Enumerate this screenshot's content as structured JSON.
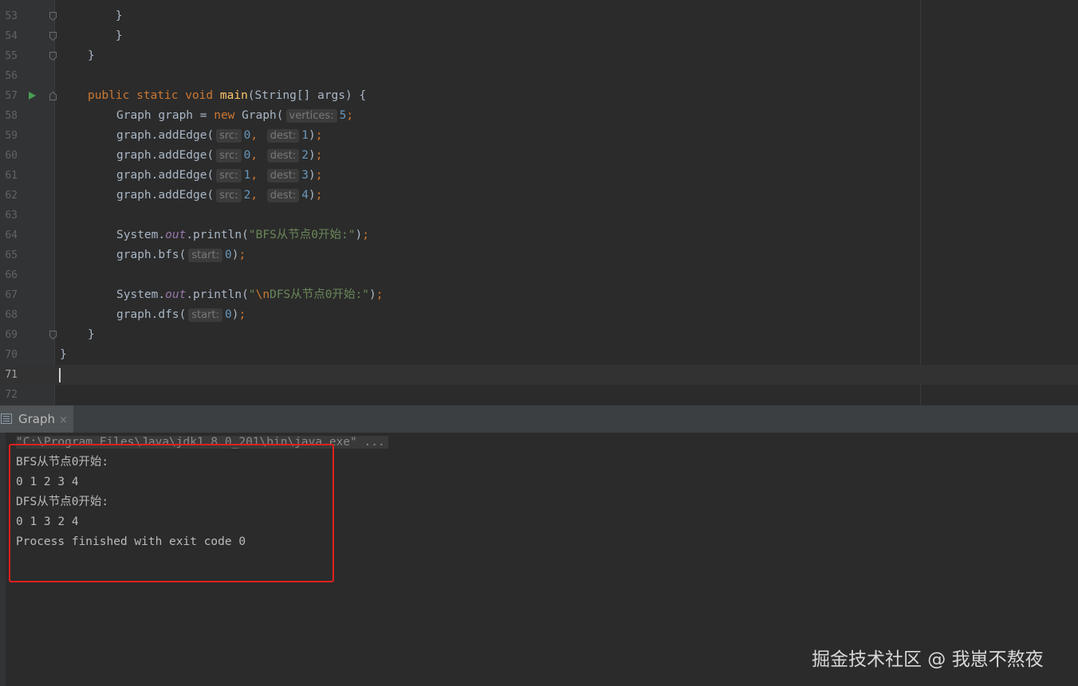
{
  "editor": {
    "lines": [
      {
        "n": "53",
        "code": "            }"
      },
      {
        "n": "54",
        "code": "        }"
      },
      {
        "n": "55",
        "code": "    }"
      },
      {
        "n": "56",
        "code": ""
      },
      {
        "n": "57",
        "code": "    public static void main(String[] args) {"
      },
      {
        "n": "58",
        "code": "        Graph graph = new Graph( vertices: 5);"
      },
      {
        "n": "59",
        "code": "        graph.addEdge( src: 0,  dest: 1);"
      },
      {
        "n": "60",
        "code": "        graph.addEdge( src: 0,  dest: 2);"
      },
      {
        "n": "61",
        "code": "        graph.addEdge( src: 1,  dest: 3);"
      },
      {
        "n": "62",
        "code": "        graph.addEdge( src: 2,  dest: 4);"
      },
      {
        "n": "63",
        "code": ""
      },
      {
        "n": "64",
        "code": "        System.out.println(\"BFS从节点0开始:\");"
      },
      {
        "n": "65",
        "code": "        graph.bfs( start: 0);"
      },
      {
        "n": "66",
        "code": ""
      },
      {
        "n": "67",
        "code": "        System.out.println(\"\\nDFS从节点0开始:\");"
      },
      {
        "n": "68",
        "code": "        graph.dfs( start: 0);"
      },
      {
        "n": "69",
        "code": "    }"
      },
      {
        "n": "70",
        "code": "}"
      },
      {
        "n": "71",
        "code": ""
      },
      {
        "n": "72",
        "code": ""
      }
    ]
  },
  "run_panel": {
    "tab_label": "Graph",
    "tab_close": "×",
    "tab_icon": "console-icon",
    "command": "\"C:\\Program Files\\Java\\jdk1.8.0_201\\bin\\java.exe\" ...",
    "output": [
      "BFS从节点0开始:",
      "0 1 2 3 4",
      "DFS从节点0开始:",
      "0 1 3 2 4",
      "Process finished with exit code 0"
    ]
  },
  "watermark": "掘金技术社区 @ 我崽不熬夜",
  "colors": {
    "keyword": "#cc7832",
    "method": "#ffc66d",
    "number": "#6897bb",
    "string": "#6a8759",
    "static_field": "#9876aa",
    "highlight_box": "#e02020"
  }
}
